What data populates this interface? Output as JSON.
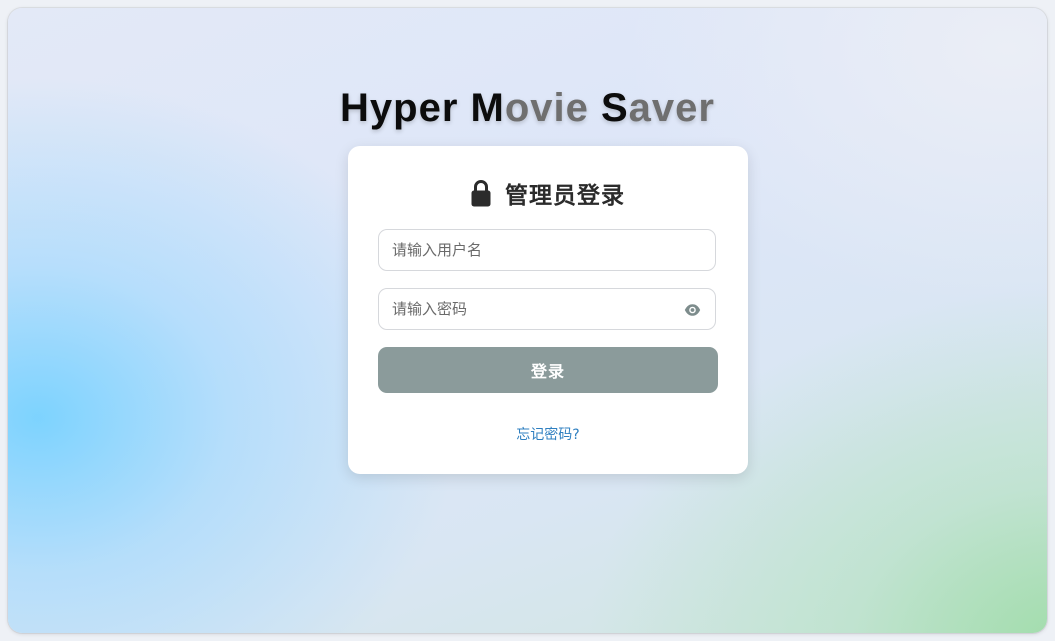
{
  "app": {
    "title_parts": [
      {
        "text": "Hyper ",
        "tone": "dark"
      },
      {
        "text": "M",
        "tone": "dark"
      },
      {
        "text": "ovie",
        "tone": "grey"
      },
      {
        "text": " S",
        "tone": "dark"
      },
      {
        "text": "aver",
        "tone": "grey"
      }
    ]
  },
  "login": {
    "title": "管理员登录",
    "title_icon": "lock-icon",
    "username": {
      "value": "",
      "placeholder": "请输入用户名"
    },
    "password": {
      "value": "",
      "placeholder": "请输入密码",
      "toggle_icon": "eye-icon"
    },
    "submit_label": "登录",
    "forgot_label": "忘记密码?"
  },
  "colors": {
    "button_bg": "#8b9b9b",
    "link": "#2e7fc0",
    "title_dark": "#0c0c0c",
    "title_grey": "#6f6f6f"
  }
}
